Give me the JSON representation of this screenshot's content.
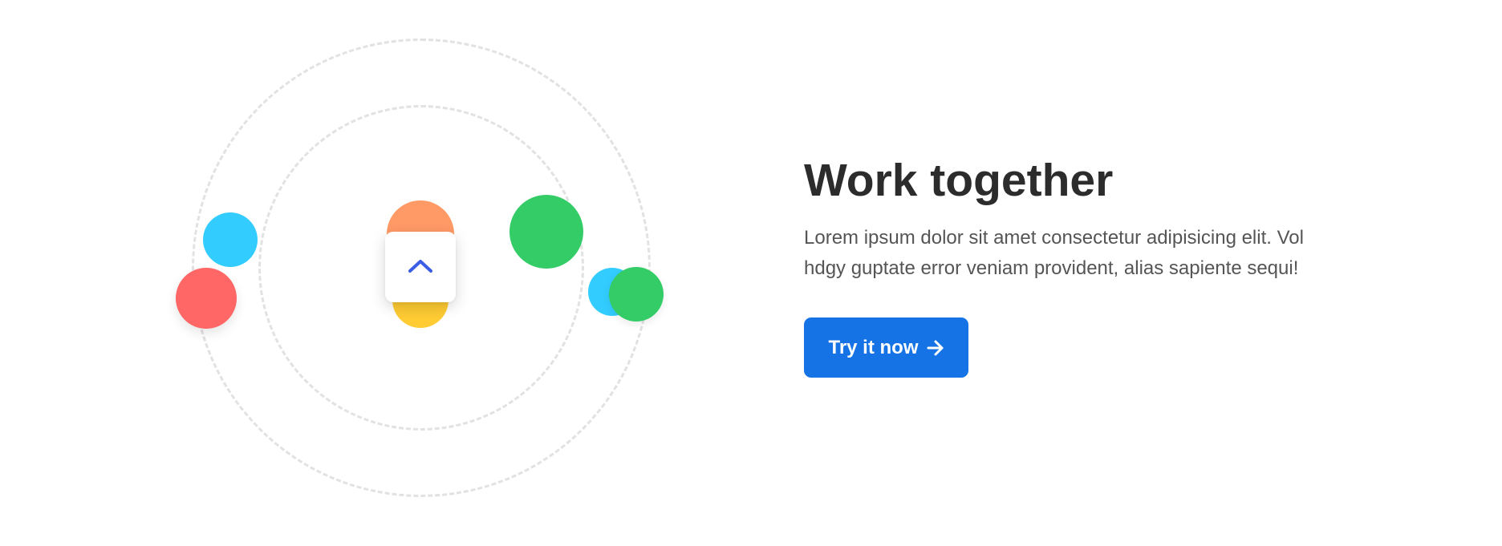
{
  "colors": {
    "accent": "#1673e6",
    "orange": "#ff9966",
    "yellow": "#ffcc33",
    "blue": "#33ccff",
    "red": "#ff6666",
    "green": "#33cc66",
    "chevron": "#3b5de7"
  },
  "illustration": {
    "center_icon": "chevron-up-icon"
  },
  "content": {
    "title": "Work together",
    "description": "Lorem ipsum dolor sit amet consectetur adipisicing elit. Vol hdgy guptate error veniam provident, alias sapiente sequi!",
    "cta_label": "Try it now",
    "cta_icon": "arrow-right-icon"
  }
}
